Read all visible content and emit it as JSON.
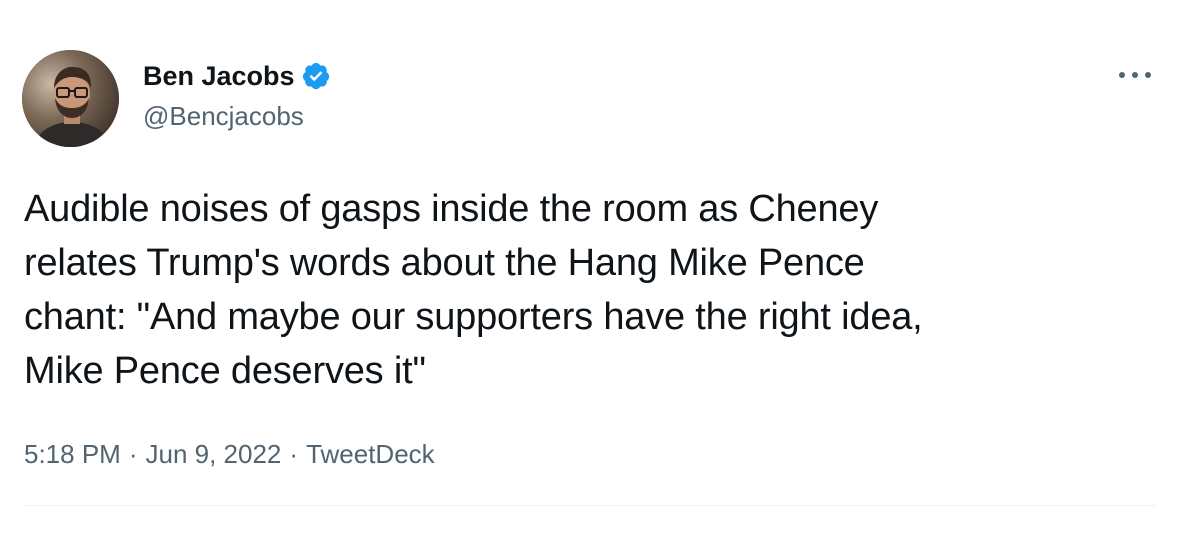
{
  "tweet": {
    "author": {
      "name": "Ben Jacobs",
      "handle": "@Bencjacobs",
      "verified": true,
      "avatar_icon": "profile-photo"
    },
    "text": "Audible noises of gasps inside the room as Cheney\nrelates Trump's words about the Hang Mike Pence\nchant: \"And maybe our supporters have the right idea,\nMike Pence deserves it\"",
    "meta": {
      "time": "5:18 PM",
      "separator": "·",
      "date": "Jun 9, 2022",
      "source": "TweetDeck"
    },
    "more_icon": "more-horizontal-icon"
  },
  "colors": {
    "text_primary": "#0f1419",
    "text_secondary": "#536471",
    "verified_blue": "#1d9bf0",
    "divider": "#eff3f4"
  }
}
